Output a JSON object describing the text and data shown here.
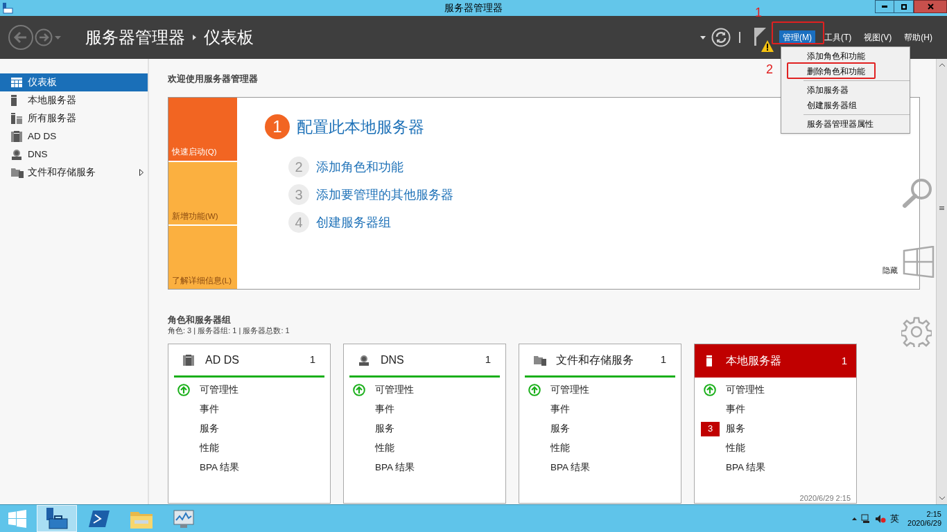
{
  "window": {
    "title": "服务器管理器"
  },
  "header": {
    "breadcrumb": [
      "服务器管理器",
      "仪表板"
    ],
    "menu": [
      {
        "label": "管理(M)",
        "selected": true
      },
      {
        "label": "工具(T)",
        "selected": false
      },
      {
        "label": "视图(V)",
        "selected": false
      },
      {
        "label": "帮助(H)",
        "selected": false
      }
    ]
  },
  "dropdown": {
    "groups": [
      [
        "添加角色和功能",
        "删除角色和功能"
      ],
      [
        "添加服务器",
        "创建服务器组"
      ],
      [
        "服务器管理器属性"
      ]
    ]
  },
  "sidebar": {
    "items": [
      {
        "label": "仪表板",
        "kind": "dashboard",
        "selected": true,
        "expandable": false
      },
      {
        "label": "本地服务器",
        "kind": "server",
        "selected": false,
        "expandable": false
      },
      {
        "label": "所有服务器",
        "kind": "servers",
        "selected": false,
        "expandable": false
      },
      {
        "label": "AD DS",
        "kind": "adds",
        "selected": false,
        "expandable": false
      },
      {
        "label": "DNS",
        "kind": "dns",
        "selected": false,
        "expandable": false
      },
      {
        "label": "文件和存储服务",
        "kind": "files",
        "selected": false,
        "expandable": true
      }
    ]
  },
  "welcome": {
    "title": "欢迎使用服务器管理器",
    "tiles": [
      {
        "label": "快速启动(Q)",
        "selected": true
      },
      {
        "label": "新增功能(W)",
        "selected": false
      },
      {
        "label": "了解详细信息(L)",
        "selected": false
      }
    ],
    "steps": [
      {
        "number": "1",
        "label": "配置此本地服务器",
        "selected": true
      },
      {
        "number": "2",
        "label": "添加角色和功能",
        "selected": false
      },
      {
        "number": "3",
        "label": "添加要管理的其他服务器",
        "selected": false
      },
      {
        "number": "4",
        "label": "创建服务器组",
        "selected": false
      }
    ],
    "hide": "隐藏"
  },
  "roles": {
    "title": "角色和服务器组",
    "summary": "角色: 3 | 服务器组: 1 | 服务器总数: 1",
    "cards": [
      {
        "title": "AD DS",
        "kind": "adds",
        "count": "1",
        "alert": false,
        "rows": [
          {
            "label": "可管理性",
            "healthy": true
          },
          {
            "label": "事件",
            "healthy": false
          },
          {
            "label": "服务",
            "healthy": false
          },
          {
            "label": "性能",
            "healthy": false
          },
          {
            "label": "BPA 结果",
            "healthy": false
          }
        ]
      },
      {
        "title": "DNS",
        "kind": "dns",
        "count": "1",
        "alert": false,
        "rows": [
          {
            "label": "可管理性",
            "healthy": true
          },
          {
            "label": "事件",
            "healthy": false
          },
          {
            "label": "服务",
            "healthy": false
          },
          {
            "label": "性能",
            "healthy": false
          },
          {
            "label": "BPA 结果",
            "healthy": false
          }
        ]
      },
      {
        "title": "文件和存储服务",
        "kind": "files",
        "count": "1",
        "alert": false,
        "rows": [
          {
            "label": "可管理性",
            "healthy": true
          },
          {
            "label": "事件",
            "healthy": false
          },
          {
            "label": "服务",
            "healthy": false
          },
          {
            "label": "性能",
            "healthy": false
          },
          {
            "label": "BPA 结果",
            "healthy": false
          }
        ]
      },
      {
        "title": "本地服务器",
        "kind": "server",
        "count": "1",
        "alert": true,
        "timestamp": "2020/6/29 2:15",
        "rows": [
          {
            "label": "可管理性",
            "healthy": true
          },
          {
            "label": "事件",
            "healthy": false
          },
          {
            "label": "服务",
            "healthy": false,
            "badge": "3"
          },
          {
            "label": "性能",
            "healthy": false
          },
          {
            "label": "BPA 结果",
            "healthy": false
          }
        ]
      }
    ]
  },
  "taskbar": {
    "apps": [
      {
        "kind": "server-manager",
        "selected": true
      },
      {
        "kind": "powershell",
        "selected": false
      },
      {
        "kind": "explorer",
        "selected": false
      },
      {
        "kind": "monitor",
        "selected": false
      }
    ],
    "tray": {
      "ime": "英",
      "time": "2:15",
      "date": "2020/6/29"
    }
  },
  "annotations": [
    {
      "label": "1"
    },
    {
      "label": "2"
    }
  ]
}
